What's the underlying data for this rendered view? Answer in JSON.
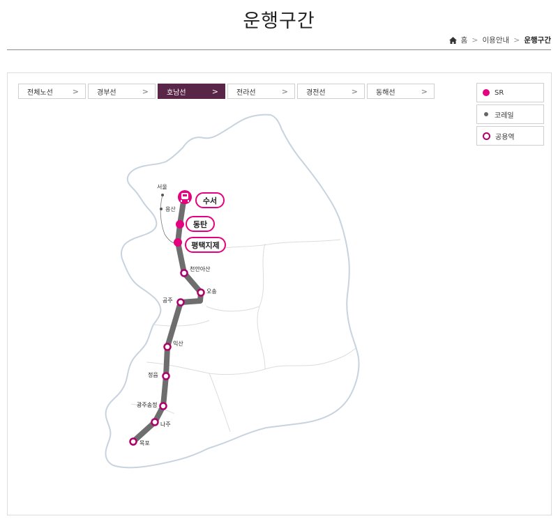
{
  "page": {
    "title": "운행구간"
  },
  "breadcrumb": {
    "home": "홈",
    "parent": "이용안내",
    "current": "운행구간"
  },
  "tabs": [
    {
      "label": "전체노선",
      "active": false
    },
    {
      "label": "경부선",
      "active": false
    },
    {
      "label": "호남선",
      "active": true
    },
    {
      "label": "전라선",
      "active": false
    },
    {
      "label": "경전선",
      "active": false
    },
    {
      "label": "동해선",
      "active": false
    }
  ],
  "legend": [
    {
      "label": "SR",
      "icon": "sr-dot"
    },
    {
      "label": "코레일",
      "icon": "korail-dot"
    },
    {
      "label": "공용역",
      "icon": "shared-station-ring"
    }
  ],
  "map": {
    "other_stations": [
      "서울",
      "용산"
    ],
    "sr_stations": [
      "수서",
      "동탄",
      "평택지제"
    ],
    "shared_stations": [
      "천안아산",
      "오송",
      "공주",
      "익산",
      "정읍",
      "광주송정",
      "나주",
      "목포"
    ],
    "colors": {
      "sr": "#e4007f",
      "shared_ring": "#b0006b",
      "route": "#6e6e6e",
      "active_tab": "#5a2648"
    }
  }
}
